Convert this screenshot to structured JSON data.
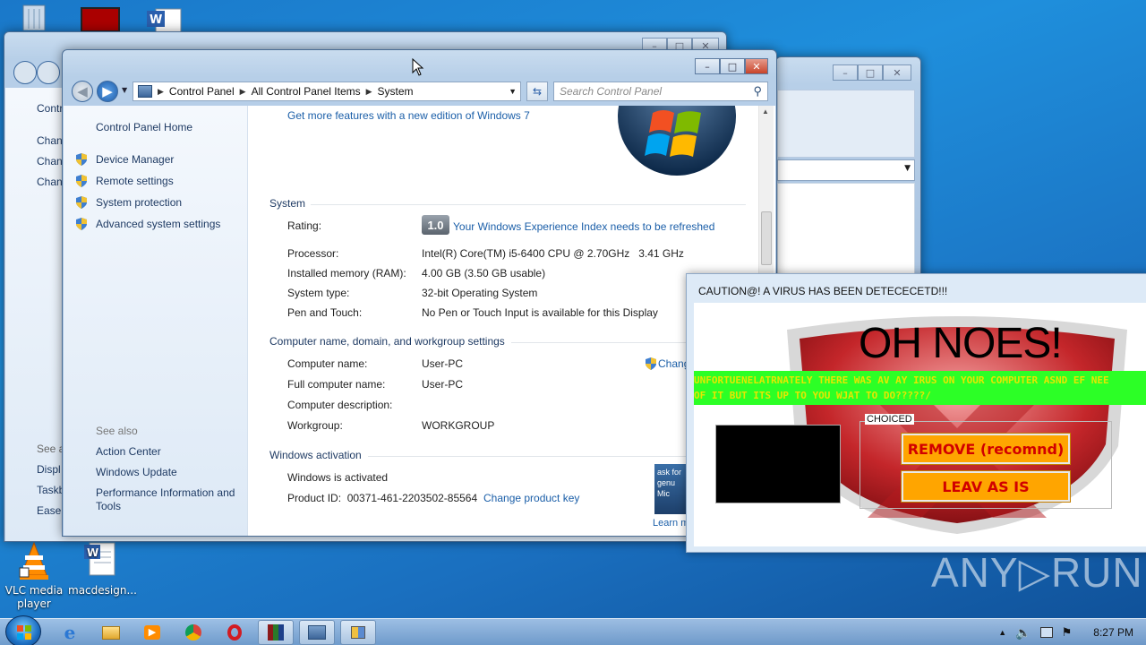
{
  "desktop": {
    "icons": [
      {
        "label": "VLC media player"
      },
      {
        "label": "macdesign..."
      }
    ],
    "watermark": "ANY▷RUN"
  },
  "back_window": {
    "sidebar_items": [
      "Contr",
      "Chan",
      "Chan",
      "Chan"
    ],
    "see_also_items": [
      "See a",
      "Displ",
      "Taskb",
      "Ease o"
    ]
  },
  "window": {
    "nav": {
      "breadcrumbs": [
        "Control Panel",
        "All Control Panel Items",
        "System"
      ],
      "search_placeholder": "Search Control Panel"
    },
    "left_pane": {
      "home_link": "Control Panel Home",
      "tasks": [
        "Device Manager",
        "Remote settings",
        "System protection",
        "Advanced system settings"
      ],
      "see_also_title": "See also",
      "see_also": [
        "Action Center",
        "Windows Update",
        "Performance Information and Tools"
      ]
    },
    "main": {
      "get_more_link": "Get more features with a new edition of Windows 7",
      "system_section": {
        "title": "System",
        "rows": [
          {
            "label": "Rating:",
            "value": "Your Windows Experience Index needs to be refreshed",
            "badge": "1.0"
          },
          {
            "label": "Processor:",
            "value": "Intel(R) Core(TM) i5-6400 CPU @ 2.70GHz   3.41 GHz"
          },
          {
            "label": "Installed memory (RAM):",
            "value": "4.00 GB (3.50 GB usable)"
          },
          {
            "label": "System type:",
            "value": "32-bit Operating System"
          },
          {
            "label": "Pen and Touch:",
            "value": "No Pen or Touch Input is available for this Display"
          }
        ]
      },
      "computer_section": {
        "title": "Computer name, domain, and workgroup settings",
        "change_link": "Chang",
        "rows": [
          {
            "label": "Computer name:",
            "value": "User-PC"
          },
          {
            "label": "Full computer name:",
            "value": "User-PC"
          },
          {
            "label": "Computer description:",
            "value": ""
          },
          {
            "label": "Workgroup:",
            "value": "WORKGROUP"
          }
        ]
      },
      "activation_section": {
        "title": "Windows activation",
        "status": "Windows is activated",
        "product_id": "Product ID:  00371-461-2203502-85564",
        "change_key_link": "Change product key",
        "genuine_text": "ask for genu Mic",
        "learn_more": "Learn m"
      }
    }
  },
  "virus_popup": {
    "title": "CAUTION@! A VIRUS HAS BEEN DETECECETD!!!",
    "headline": "OH NOES!",
    "message_line1": "UNFORTUENELATRNATELY THERE WAS AV AY IRUS ON YOUR COMPUTER ASND EF NEE",
    "message_line2": "OF IT BUT ITS UP TO YOU WJAT TO DO?????/",
    "choices_label": "CHOICED",
    "remove_button": "REMOVE (recomnd)",
    "leave_button": "LEAV AS IS",
    "colors": {
      "banner": "#2cff26",
      "banner_text": "#e7e700",
      "button": "#ffa500",
      "button_text": "#d10000"
    }
  },
  "taskbar": {
    "clock": "8:27 PM"
  }
}
